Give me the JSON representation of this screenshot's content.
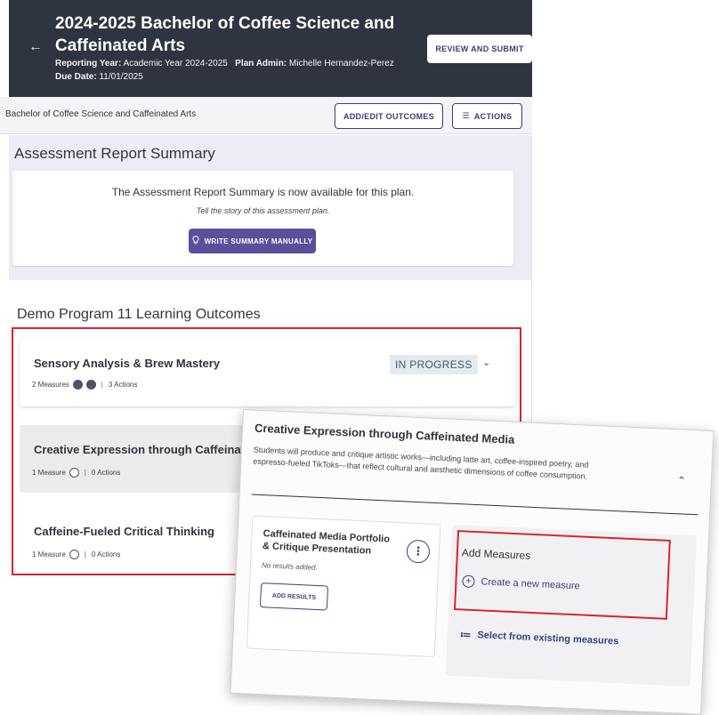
{
  "header": {
    "title": "2024-2025 Bachelor of Coffee Science and Caffeinated Arts",
    "reporting_year_label": "Reporting Year:",
    "reporting_year_value": "Academic Year 2024-2025",
    "plan_admin_label": "Plan Admin:",
    "plan_admin_value": "Michelle Hernandez-Perez",
    "due_date_label": "Due Date:",
    "due_date_value": "11/01/2025",
    "review_button": "REVIEW AND SUBMIT"
  },
  "subbar": {
    "plan_name": "Bachelor of Coffee Science and Caffeinated Arts",
    "add_edit_button": "ADD/EDIT OUTCOMES",
    "actions_button": "ACTIONS"
  },
  "summary": {
    "heading": "Assessment Report Summary",
    "message": "The Assessment Report Summary is now available for this plan.",
    "prompt": "Tell the story of this assessment plan.",
    "write_button": "WRITE SUMMARY MANUALLY"
  },
  "outcomes": {
    "heading": "Demo Program 11 Learning Outcomes",
    "items": [
      {
        "title": "Sensory Analysis & Brew Mastery",
        "measures": "2 Measures",
        "actions": "3 Actions",
        "status": "IN PROGRESS"
      },
      {
        "title": "Creative Expression through Caffeinat",
        "measures": "1 Measure",
        "actions": "0 Actions"
      },
      {
        "title": "Caffeine-Fueled Critical Thinking",
        "measures": "1 Measure",
        "actions": "0 Actions"
      }
    ]
  },
  "zoom_card": {
    "title": "Creative Expression through Caffeinated Media",
    "description": "Students will produce and critique artistic works—including latte art, coffee-inspired poetry, and espresso-fueled TikToks—that reflect cultural and aesthetic dimensions of coffee consumption.",
    "measure": {
      "title": "Caffeinated Media Portfolio & Critique Presentation",
      "status": "No results added.",
      "button": "ADD RESULTS"
    },
    "add_measures": {
      "title": "Add Measures",
      "create": "Create a new measure",
      "select": "Select from existing measures"
    }
  },
  "colors": {
    "header_bg": "#2f3540",
    "accent": "#3b3f7a",
    "primary_button": "#5b4f9c",
    "highlight": "#d7262e",
    "summary_region": "#edecf6"
  },
  "icons": {
    "back": "arrow-left-icon",
    "actions": "list-icon",
    "write": "lightbulb-icon",
    "expand": "chevron-down-icon",
    "collapse": "chevron-up-icon",
    "kebab": "more-vertical-icon",
    "create": "plus-circle-icon",
    "select": "checklist-icon"
  }
}
